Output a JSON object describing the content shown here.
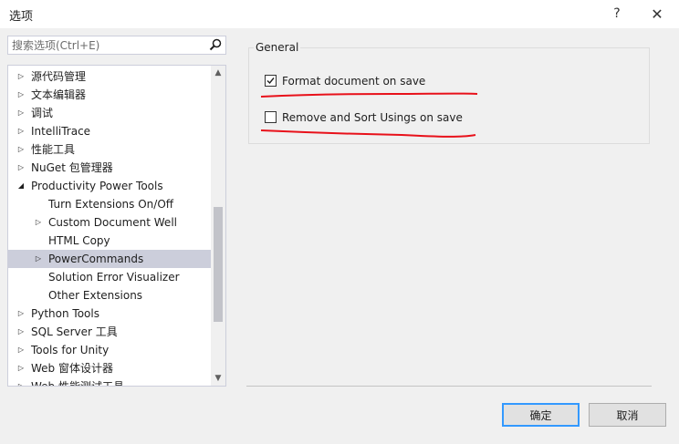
{
  "window": {
    "title": "选项",
    "help_label": "?",
    "close_label": "✕"
  },
  "search": {
    "placeholder": "搜索选项(Ctrl+E)",
    "value": ""
  },
  "tree": {
    "items": [
      {
        "label": "源代码管理",
        "level": 0,
        "arrow": "▷"
      },
      {
        "label": "文本编辑器",
        "level": 0,
        "arrow": "▷"
      },
      {
        "label": "调试",
        "level": 0,
        "arrow": "▷"
      },
      {
        "label": "IntelliTrace",
        "level": 0,
        "arrow": "▷"
      },
      {
        "label": "性能工具",
        "level": 0,
        "arrow": "▷"
      },
      {
        "label": "NuGet 包管理器",
        "level": 0,
        "arrow": "▷"
      },
      {
        "label": "Productivity Power Tools",
        "level": 0,
        "arrow": "◢"
      },
      {
        "label": "Turn Extensions On/Off",
        "level": 1,
        "arrow": ""
      },
      {
        "label": "Custom Document Well",
        "level": 1,
        "arrow": "▷"
      },
      {
        "label": "HTML Copy",
        "level": 1,
        "arrow": ""
      },
      {
        "label": "PowerCommands",
        "level": 1,
        "arrow": "▷",
        "selected": true
      },
      {
        "label": "Solution Error Visualizer",
        "level": 1,
        "arrow": ""
      },
      {
        "label": "Other Extensions",
        "level": 1,
        "arrow": ""
      },
      {
        "label": "Python Tools",
        "level": 0,
        "arrow": "▷"
      },
      {
        "label": "SQL Server 工具",
        "level": 0,
        "arrow": "▷"
      },
      {
        "label": "Tools for Unity",
        "level": 0,
        "arrow": "▷"
      },
      {
        "label": "Web 窗体设计器",
        "level": 0,
        "arrow": "▷"
      },
      {
        "label": "Web 性能测试工具",
        "level": 0,
        "arrow": "▷"
      }
    ],
    "scroll_up": "▲",
    "scroll_down": "▼"
  },
  "general": {
    "title": "General",
    "options": [
      {
        "label": "Format document on save",
        "checked": true
      },
      {
        "label": "Remove and Sort Usings on save",
        "checked": false
      }
    ]
  },
  "buttons": {
    "ok": "确定",
    "cancel": "取消"
  },
  "colors": {
    "selection": "#cccedb",
    "annotation_red": "#e8111a",
    "ok_border": "#3399ff"
  },
  "icons": {
    "search": "search-icon",
    "checkmark": "checkmark-icon"
  }
}
